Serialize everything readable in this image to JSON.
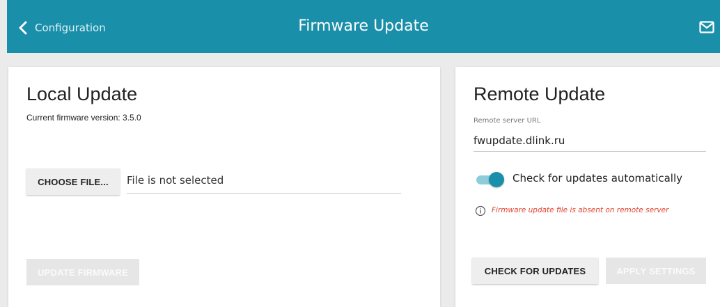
{
  "header": {
    "back_label": "Configuration",
    "title": "Firmware Update",
    "bg_color": "#1a8fa9",
    "back_icon": "chevron-left-icon",
    "mail_icon": "mail-icon"
  },
  "local_update": {
    "title": "Local Update",
    "current_version_text": "Current firmware version: 3.5.0",
    "choose_file_label": "CHOOSE FILE...",
    "file_status": "File is not selected",
    "update_button_label": "UPDATE FIRMWARE",
    "update_button_enabled": false
  },
  "remote_update": {
    "title": "Remote Update",
    "url_label": "Remote server URL",
    "url_value": "fwupdate.dlink.ru",
    "auto_check_label": "Check for updates automatically",
    "auto_check_enabled": true,
    "warning_icon": "info-circle-icon",
    "warning_text": "Firmware update file is absent on remote server",
    "warning_color": "#e2442f",
    "check_button_label": "CHECK FOR UPDATES",
    "apply_button_label": "APPLY SETTINGS",
    "apply_button_enabled": false
  }
}
